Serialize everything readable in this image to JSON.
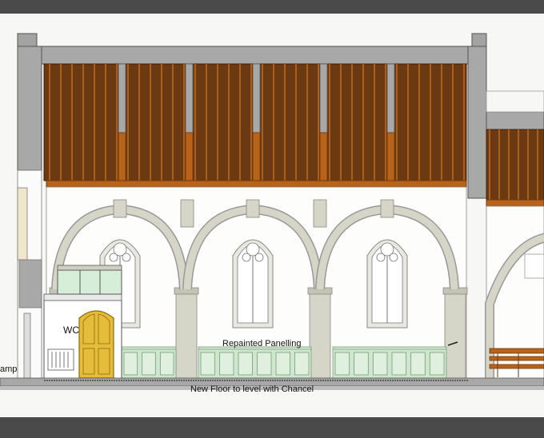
{
  "labels": {
    "wc": "WC",
    "panelling": "Repainted Panelling",
    "floor": "New Floor to level with Chancel",
    "ramp_fragment": "amp"
  },
  "colors": {
    "frame": "#4a4a4a",
    "sheet": "#f7f7f5",
    "wall": "#a8a8a8",
    "timber": "#6b3a12",
    "timber_light": "#b8621a",
    "stone": "#d6d6c8",
    "panel": "#cfe6cf",
    "door": "#e6bd3a"
  },
  "bays": [
    {
      "name": "bay-1"
    },
    {
      "name": "bay-2"
    },
    {
      "name": "bay-3"
    }
  ]
}
